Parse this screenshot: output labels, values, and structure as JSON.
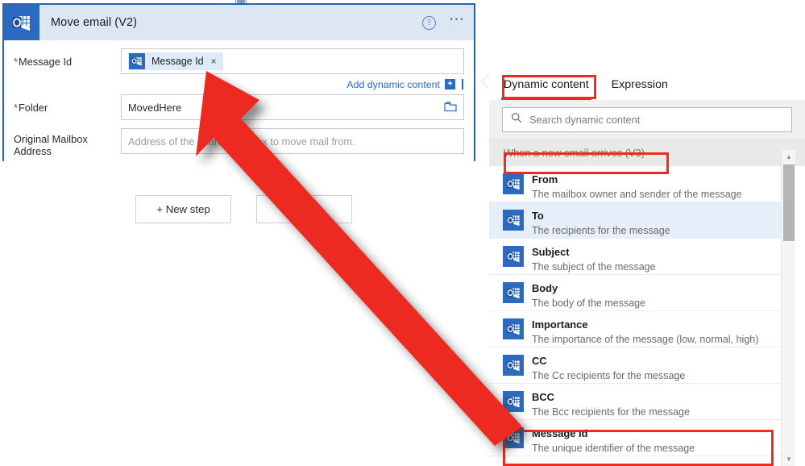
{
  "card": {
    "icon": "outlook-icon",
    "title": "Move email (V2)",
    "help_icon": "help-circle-icon",
    "more_icon": "ellipsis-icon",
    "fields": [
      {
        "label": "Message Id",
        "required": true,
        "token": {
          "label": "Message Id",
          "remove": "×",
          "icon": "outlook-icon"
        }
      },
      {
        "label": "Folder",
        "required": true,
        "value": "MovedHere",
        "trailing_icon": "folder-icon"
      },
      {
        "label": "Original Mailbox Address",
        "required": false,
        "placeholder": "Address of the shared mailbox to move mail from."
      }
    ],
    "add_dynamic_content": "Add dynamic content",
    "add_dynamic_plus": "+"
  },
  "buttons": {
    "new_step": "+ New step",
    "save": "Save"
  },
  "dynamic_panel": {
    "tabs": [
      {
        "label": "Dynamic content",
        "active": true
      },
      {
        "label": "Expression",
        "active": false
      }
    ],
    "search": {
      "placeholder": "Search dynamic content",
      "icon": "search-icon"
    },
    "group_header": "When a new email arrives (V3)",
    "items": [
      {
        "title": "From",
        "desc": "The mailbox owner and sender of the message",
        "icon": "outlook-icon",
        "selected": false
      },
      {
        "title": "To",
        "desc": "The recipients for the message",
        "icon": "outlook-icon",
        "selected": true
      },
      {
        "title": "Subject",
        "desc": "The subject of the message",
        "icon": "outlook-icon",
        "selected": false
      },
      {
        "title": "Body",
        "desc": "The body of the message",
        "icon": "outlook-icon",
        "selected": false
      },
      {
        "title": "Importance",
        "desc": "The importance of the message (low, normal, high)",
        "icon": "outlook-icon",
        "selected": false
      },
      {
        "title": "CC",
        "desc": "The Cc recipients for the message",
        "icon": "outlook-icon",
        "selected": false
      },
      {
        "title": "BCC",
        "desc": "The Bcc recipients for the message",
        "icon": "outlook-icon",
        "selected": false
      },
      {
        "title": "Message Id",
        "desc": "The unique identifier of the message",
        "icon": "outlook-icon",
        "selected": false
      }
    ],
    "scrollbar": {
      "up_icon": "scroll-up-arrow-icon",
      "down_icon": "scroll-down-arrow-icon"
    }
  },
  "annotations": {
    "arrow_color": "#ed2b20",
    "highlight_color": "#ef2a1f",
    "arrow": "red-arrow-annotation"
  },
  "colors": {
    "accent": "#2b6ac0",
    "header_bg": "#dce7f3",
    "card_border": "#2663b0",
    "highlight": "#ef2a1f",
    "selected_row": "#e6eef9"
  }
}
